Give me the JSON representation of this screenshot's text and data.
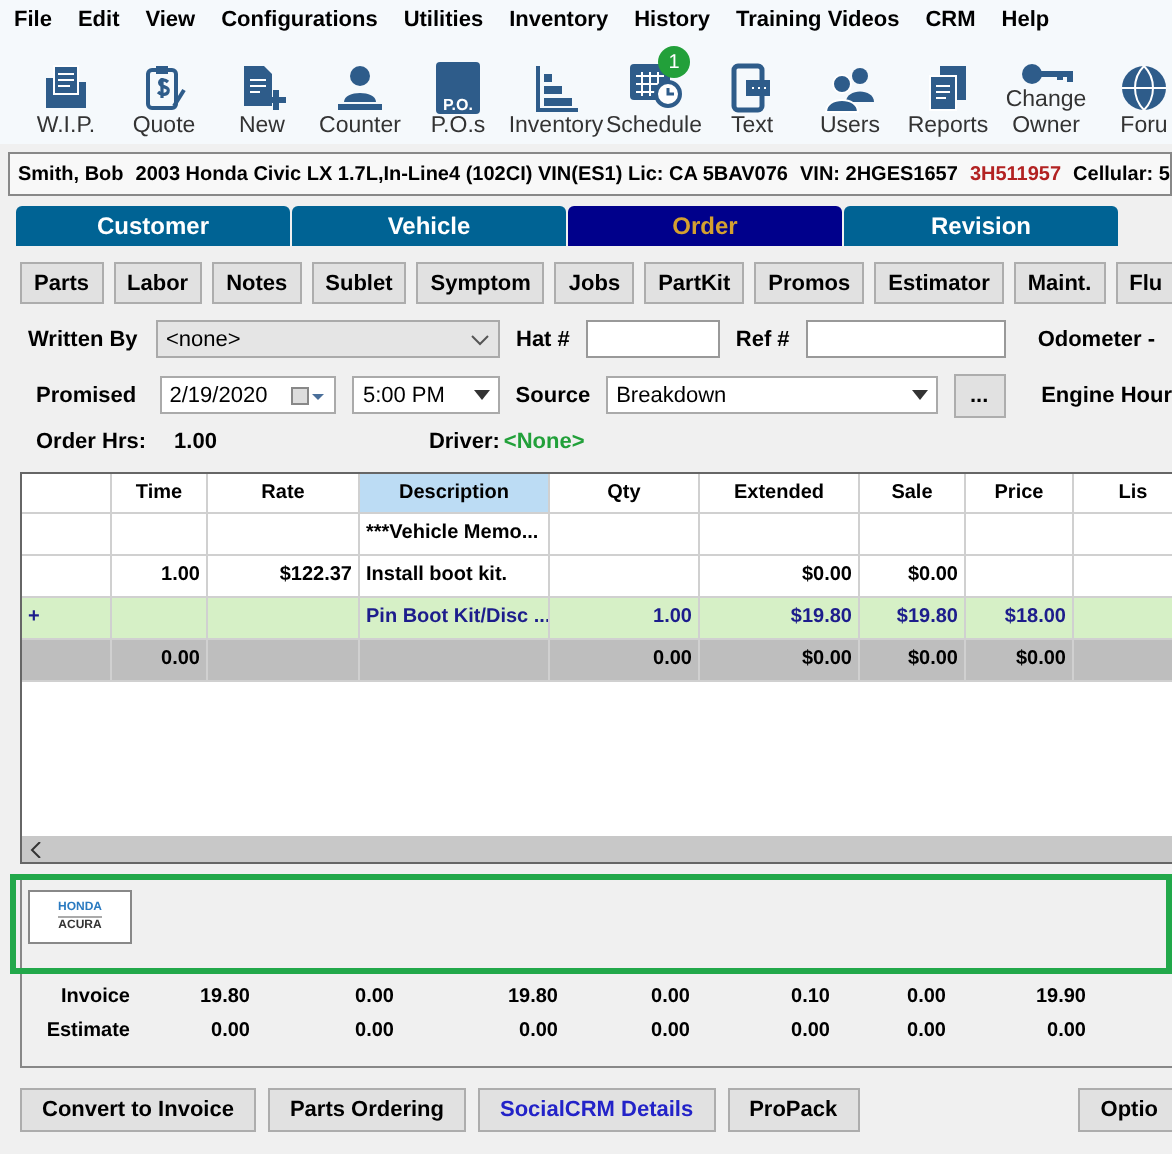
{
  "menu": [
    "File",
    "Edit",
    "View",
    "Configurations",
    "Utilities",
    "Inventory",
    "History",
    "Training Videos",
    "CRM",
    "Help"
  ],
  "toolbar": [
    {
      "kind": "wip",
      "label": "W.I.P."
    },
    {
      "kind": "quote",
      "label": "Quote"
    },
    {
      "kind": "new",
      "label": "New"
    },
    {
      "kind": "counter",
      "label": "Counter"
    },
    {
      "kind": "po",
      "label": "P.O.s",
      "icon_text": "P.O."
    },
    {
      "kind": "inventory",
      "label": "Inventory"
    },
    {
      "kind": "schedule",
      "label": "Schedule",
      "badge": "1"
    },
    {
      "kind": "text",
      "label": "Text"
    },
    {
      "kind": "users",
      "label": "Users"
    },
    {
      "kind": "reports",
      "label": "Reports"
    },
    {
      "kind": "owner",
      "label": "Change Owner"
    },
    {
      "kind": "forum",
      "label": "Foru"
    }
  ],
  "vehicle_bar": {
    "customer": "Smith, Bob",
    "vehicle": "2003  Honda Civic LX  1.7L,In-Line4 (102CI) VIN(ES1) Lic: CA 5BAV076",
    "vin_label": "VIN: 2HGES1657",
    "vin_tail": "3H511957",
    "cellular": "Cellular: 5"
  },
  "tabs": [
    {
      "label": "Customer",
      "selected": false
    },
    {
      "label": "Vehicle",
      "selected": false
    },
    {
      "label": "Order",
      "selected": true
    },
    {
      "label": "Revision",
      "selected": false
    }
  ],
  "sub_buttons": [
    "Parts",
    "Labor",
    "Notes",
    "Sublet",
    "Symptom",
    "Jobs",
    "PartKit",
    "Promos",
    "Estimator",
    "Maint.",
    "Flu"
  ],
  "form": {
    "written_by_label": "Written By",
    "written_by": "<none>",
    "hat_label": "Hat #",
    "ref_label": "Ref #",
    "odometer_label": "Odometer -",
    "promised_label": "Promised",
    "date": "2/19/2020",
    "time": "5:00 PM",
    "source_label": "Source",
    "source": "Breakdown",
    "more": "...",
    "engine_label": "Engine Hour",
    "order_hrs_label": "Order Hrs:",
    "order_hrs": "1.00",
    "driver_label": "Driver:",
    "driver": "<None>"
  },
  "table": {
    "columns": [
      {
        "selected": false
      },
      {
        "label": "Time",
        "selected": false
      },
      {
        "label": "Rate",
        "selected": false
      },
      {
        "label": "Description",
        "selected": true
      },
      {
        "label": "Qty",
        "selected": false
      },
      {
        "label": "Extended",
        "selected": false
      },
      {
        "label": "Sale",
        "selected": false
      },
      {
        "label": "Price",
        "selected": false
      },
      {
        "label": "Lis",
        "selected": false
      }
    ],
    "rows": [
      {
        "kind": "memo",
        "cells": [
          "",
          "",
          "",
          "***Vehicle Memo...",
          "",
          "",
          "",
          "",
          ""
        ]
      },
      {
        "kind": "labor",
        "cells": [
          "",
          "1.00",
          "$122.37",
          "Install boot kit.",
          "",
          "$0.00",
          "$0.00",
          "",
          ""
        ]
      },
      {
        "kind": "part",
        "cells": [
          "+",
          "",
          "",
          "Pin Boot Kit/Disc ...",
          "1.00",
          "$19.80",
          "$19.80",
          "$18.00",
          ""
        ]
      },
      {
        "kind": "total",
        "cells": [
          "",
          "0.00",
          "",
          "",
          "0.00",
          "$0.00",
          "$0.00",
          "$0.00",
          ""
        ]
      }
    ]
  },
  "logo": {
    "top": "HONDA",
    "bottom": "ACURA"
  },
  "totals": {
    "rows": [
      {
        "label": "Invoice",
        "values": [
          "19.80",
          "0.00",
          "19.80",
          "0.00",
          "0.10",
          "0.00",
          "19.90"
        ]
      },
      {
        "label": "Estimate",
        "values": [
          "0.00",
          "0.00",
          "0.00",
          "0.00",
          "0.00",
          "0.00",
          "0.00"
        ]
      }
    ]
  },
  "bottom_buttons": [
    {
      "label": "Convert to Invoice",
      "kind": "normal"
    },
    {
      "label": "Parts Ordering",
      "kind": "normal"
    },
    {
      "label": "SocialCRM Details",
      "kind": "link"
    },
    {
      "label": "ProPack",
      "kind": "normal"
    },
    {
      "label": "Optio",
      "kind": "right"
    }
  ]
}
